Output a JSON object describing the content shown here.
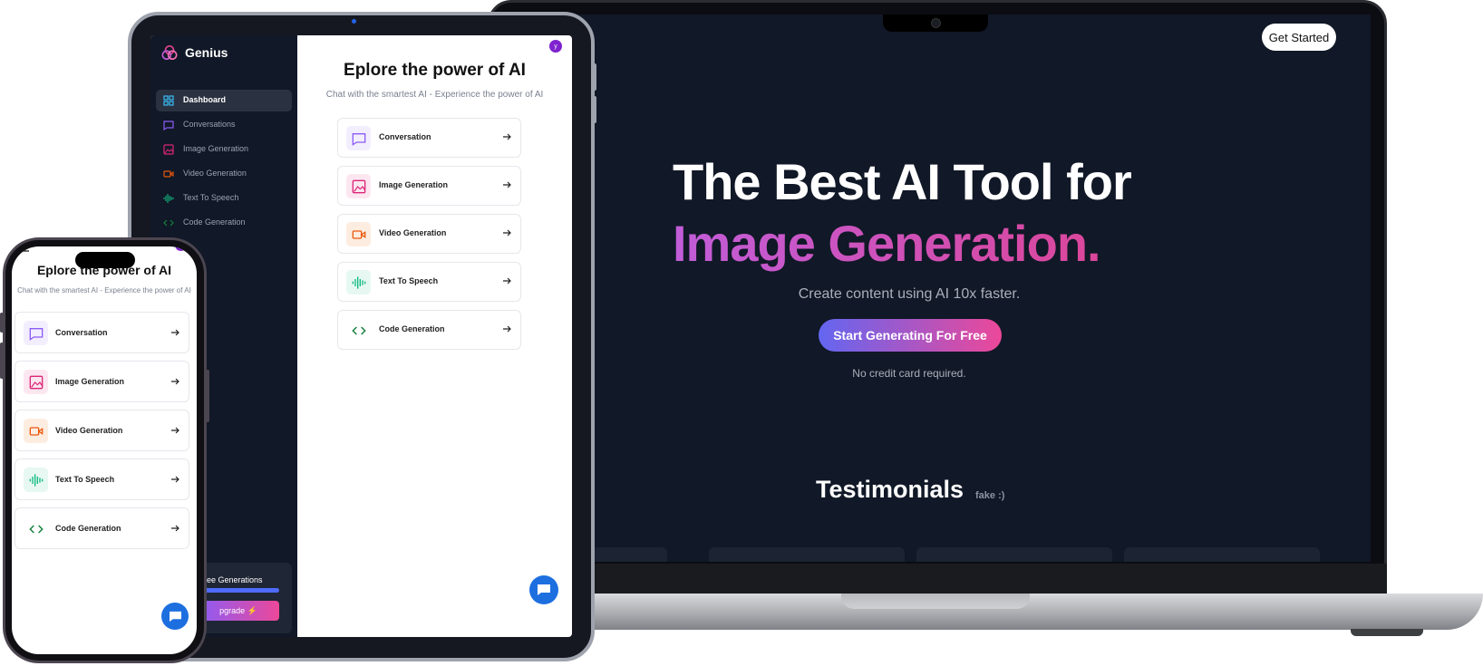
{
  "laptop": {
    "header": {
      "get_started_label": "Get Started"
    },
    "hero": {
      "line1": "The Best AI Tool for",
      "line2": "Image Generation.",
      "subtitle": "Create content using AI 10x faster.",
      "cta_label": "Start Generating For Free",
      "note": "No credit card required."
    },
    "testimonials": {
      "title": "Testimonials",
      "note": "fake :)"
    }
  },
  "app": {
    "brand": "Genius",
    "avatar_initial": "y",
    "heading": "Eplore the power of AI",
    "subheading": "Chat with the smartest AI - Experience the power of AI",
    "sidebar": {
      "items": [
        {
          "label": "Dashboard",
          "icon": "dashboard-icon",
          "color": "#38bdf8"
        },
        {
          "label": "Conversations",
          "icon": "message-icon",
          "color": "#8b5cf6"
        },
        {
          "label": "Image Generation",
          "icon": "image-icon",
          "color": "#db2777"
        },
        {
          "label": "Video Generation",
          "icon": "video-icon",
          "color": "#ea580c"
        },
        {
          "label": "Text To Speech",
          "icon": "audio-wave-icon",
          "color": "#10b981"
        },
        {
          "label": "Code Generation",
          "icon": "code-icon",
          "color": "#15803d"
        }
      ],
      "free_generations_label": "ee Generations",
      "upgrade_label": "pgrade"
    },
    "tools": [
      {
        "label": "Conversation",
        "icon": "message-icon",
        "color": "#8b5cf6",
        "bg": "#f3eefe"
      },
      {
        "label": "Image Generation",
        "icon": "image-icon",
        "color": "#db2777",
        "bg": "#fce7f1"
      },
      {
        "label": "Video Generation",
        "icon": "video-icon",
        "color": "#ea580c",
        "bg": "#fdece0"
      },
      {
        "label": "Text To Speech",
        "icon": "audio-wave-icon",
        "color": "#10b981",
        "bg": "#e6f8f1"
      },
      {
        "label": "Code Generation",
        "icon": "code-icon",
        "color": "#15803d",
        "bg": "#ffffff"
      }
    ]
  }
}
